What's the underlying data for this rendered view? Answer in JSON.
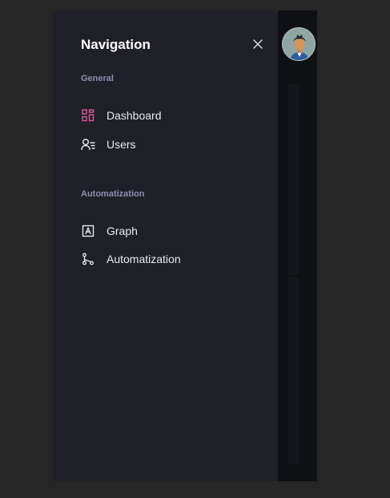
{
  "drawer": {
    "title": "Navigation",
    "close_icon": "close-icon",
    "sections": [
      {
        "label": "General",
        "items": [
          {
            "label": "Dashboard",
            "icon": "dashboard-icon",
            "icon_color": "#e0569a",
            "active": true
          },
          {
            "label": "Users",
            "icon": "users-icon",
            "icon_color": "#e8e8ef"
          }
        ]
      },
      {
        "label": "Automatization",
        "items": [
          {
            "label": "Graph",
            "icon": "graph-icon",
            "icon_color": "#e8e8ef"
          },
          {
            "label": "Automatization",
            "icon": "automatization-icon",
            "icon_color": "#e8e8ef"
          }
        ]
      }
    ]
  },
  "header": {
    "avatar": "user-avatar"
  },
  "colors": {
    "accent": "#e0569a",
    "drawer_bg": "#202029",
    "section_label": "#8f8fb0"
  }
}
